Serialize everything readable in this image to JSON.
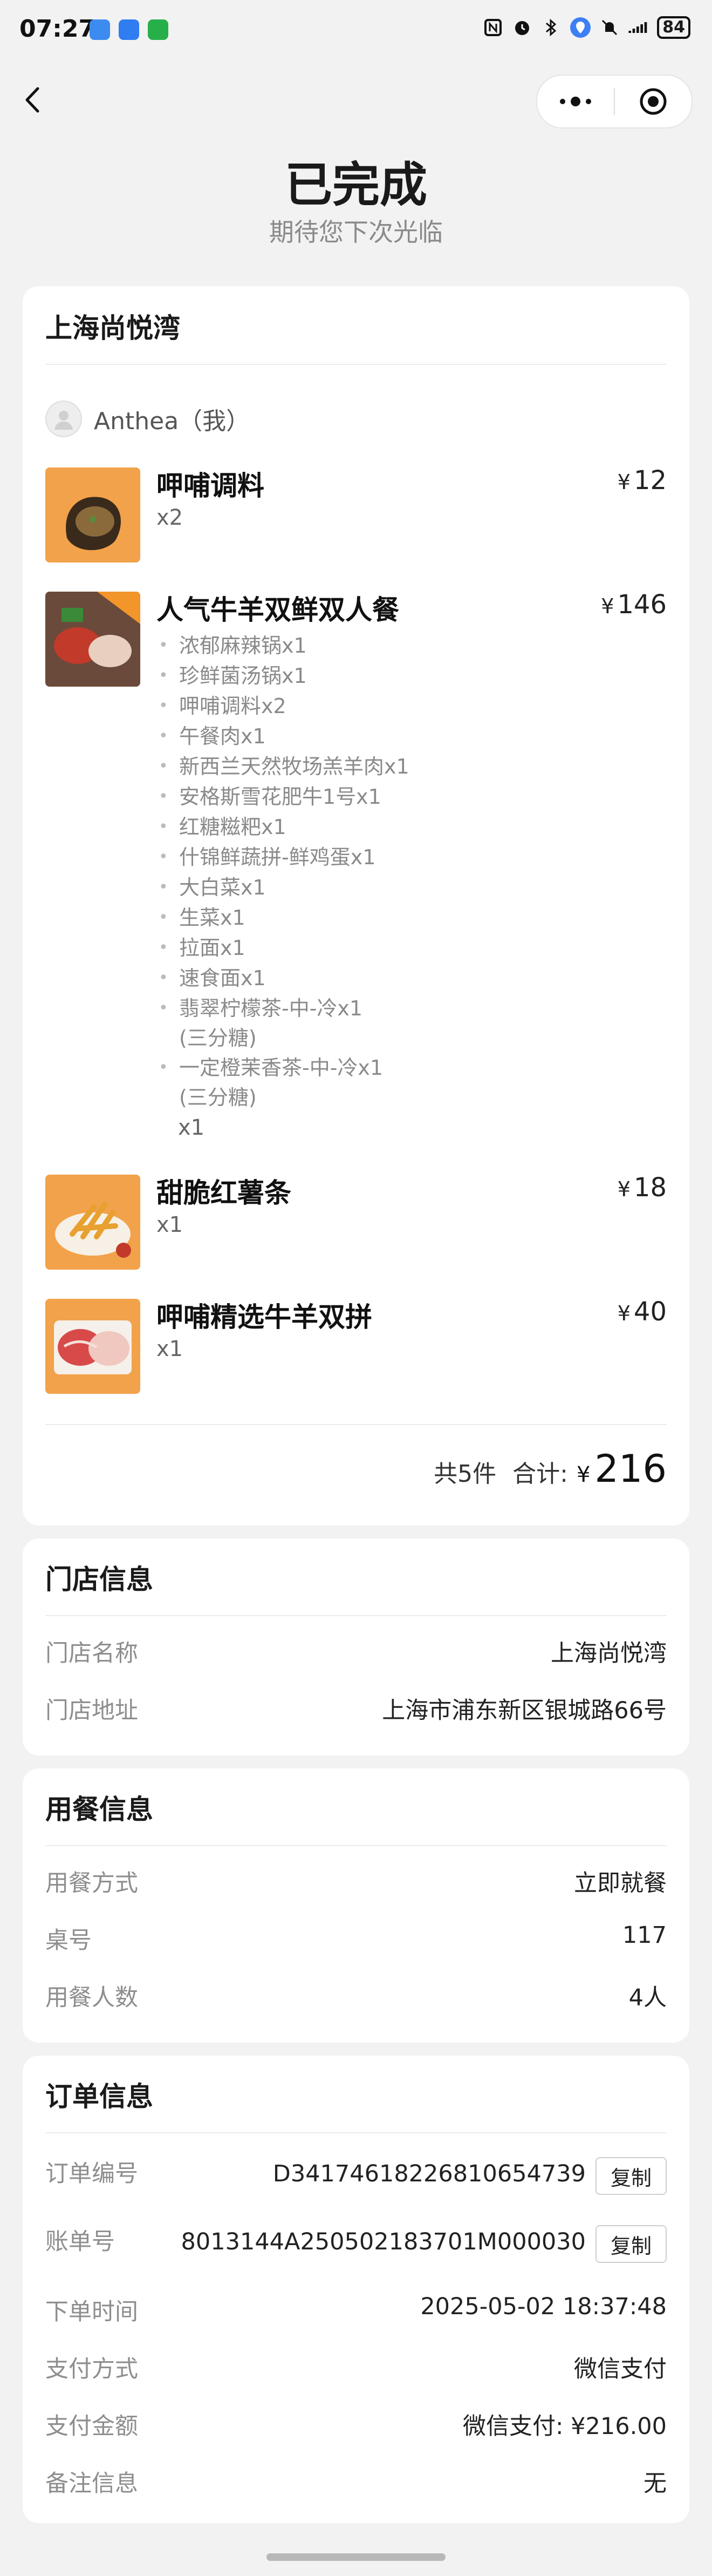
{
  "status": {
    "time": "07:27",
    "battery": "84"
  },
  "header": {
    "title": "已完成",
    "subtitle": "期待您下次光临"
  },
  "order": {
    "store_name": "上海尚悦湾",
    "user": "Anthea（我）",
    "items": [
      {
        "name": "呷哺调料",
        "qty": "x2",
        "price": "12"
      },
      {
        "name": "人气牛羊双鲜双人餐",
        "qty": "x1",
        "price": "146",
        "sub_items": [
          "浓郁麻辣锅x1",
          "珍鲜菌汤锅x1",
          "呷哺调料x2",
          "午餐肉x1",
          "新西兰天然牧场羔羊肉x1",
          "安格斯雪花肥牛1号x1",
          "红糖糍粑x1",
          "什锦鲜蔬拼-鲜鸡蛋x1",
          "大白菜x1",
          "生菜x1",
          "拉面x1",
          "速食面x1",
          "翡翠柠檬茶-中-冷x1",
          "一定橙茉香茶-中-冷x1"
        ],
        "sub_notes": [
          "(三分糖)",
          "(三分糖)"
        ]
      },
      {
        "name": "甜脆红薯条",
        "qty": "x1",
        "price": "18"
      },
      {
        "name": "呷哺精选牛羊双拼",
        "qty": "x1",
        "price": "40"
      }
    ],
    "currency": "¥",
    "total_count": "共5件",
    "total_label": "合计:",
    "total_amount": "216"
  },
  "store_info": {
    "title": "门店信息",
    "rows": [
      {
        "label": "门店名称",
        "value": "上海尚悦湾"
      },
      {
        "label": "门店地址",
        "value": "上海市浦东新区银城路66号"
      }
    ]
  },
  "dining_info": {
    "title": "用餐信息",
    "rows": [
      {
        "label": "用餐方式",
        "value": "立即就餐"
      },
      {
        "label": "桌号",
        "value": "117"
      },
      {
        "label": "用餐人数",
        "value": "4人"
      }
    ]
  },
  "order_info": {
    "title": "订单信息",
    "copy_label": "复制",
    "rows": [
      {
        "label": "订单编号",
        "value": "D34174618226810654739"
      },
      {
        "label": "账单号",
        "value": "8013144A250502183701M000030"
      },
      {
        "label": "下单时间",
        "value": "2025-05-02 18:37:48"
      },
      {
        "label": "支付方式",
        "value": "微信支付"
      },
      {
        "label": "支付金额",
        "value": "微信支付: ¥216.00"
      },
      {
        "label": "备注信息",
        "value": "无"
      }
    ]
  },
  "colors": {
    "background": "#f2f2f2",
    "card": "#ffffff",
    "label_gray": "#8e8e8e",
    "thumb_orange": "#f0a050"
  }
}
